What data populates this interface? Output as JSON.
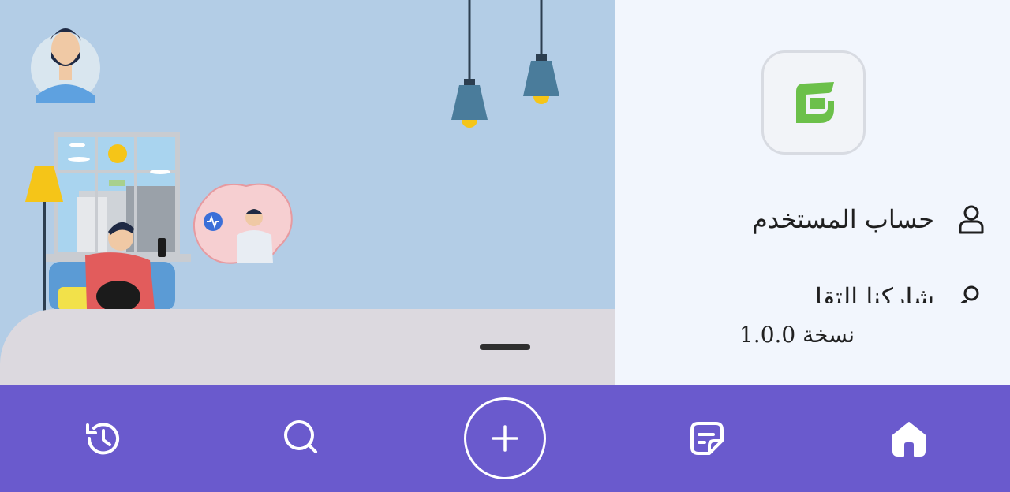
{
  "drawer": {
    "items": [
      {
        "label": "حساب المستخدم",
        "icon": "user-icon"
      },
      {
        "label": "شاركنا التقا",
        "icon": "share-icon"
      }
    ],
    "version_label": "نسخة 1.0.0"
  },
  "bottom_nav": {
    "items": [
      {
        "icon": "history-icon"
      },
      {
        "icon": "search-icon"
      },
      {
        "icon": "add-icon"
      },
      {
        "icon": "notes-icon"
      },
      {
        "icon": "home-icon"
      }
    ]
  },
  "colors": {
    "nav_bg": "#6a5acd",
    "scene_bg": "#b3cde6",
    "drawer_bg": "#f2f6fd",
    "logo_green": "#6cc04a",
    "sheet_bg": "#dcd9df"
  }
}
